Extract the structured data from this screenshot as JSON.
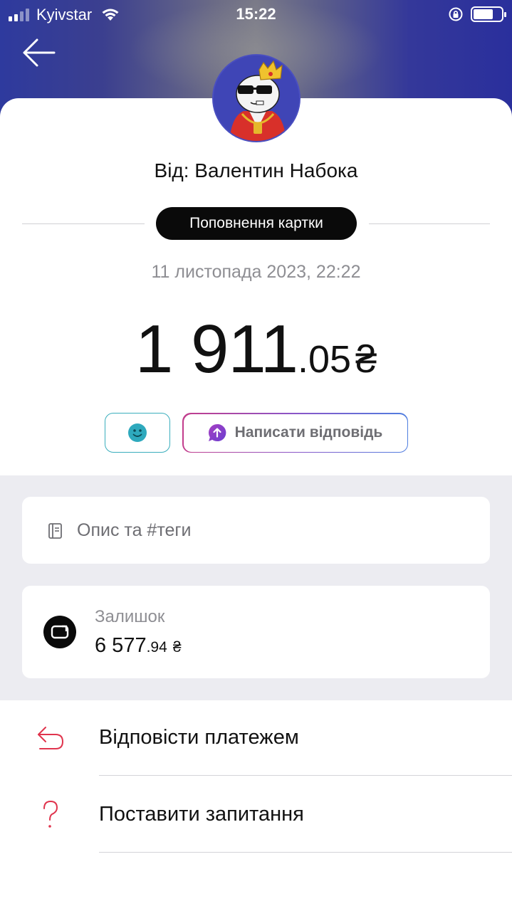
{
  "status_bar": {
    "carrier": "Kyivstar",
    "time": "15:22"
  },
  "header": {
    "back_icon": "arrow-left-icon"
  },
  "transaction": {
    "sender": "Від: Валентин Набока",
    "type": "Поповнення картки",
    "date": "11 листопада 2023, 22:22",
    "amount_integer": "1 911",
    "amount_decimal": ".05",
    "currency": "₴"
  },
  "actions": {
    "emoji_icon": "smiley-icon",
    "reply_label": "Написати відповідь"
  },
  "description": {
    "label": "Опис та #теги"
  },
  "balance": {
    "label": "Залишок",
    "integer": "6 577",
    "decimal": ".94",
    "currency": "₴"
  },
  "menu": [
    {
      "label": "Відповісти платежем",
      "icon": "reply-payment-icon"
    },
    {
      "label": "Поставити запитання",
      "icon": "question-icon"
    }
  ],
  "colors": {
    "header_blue": "#2e3a9e",
    "accent_red": "#e0344d",
    "emoji_teal": "#3aaebd",
    "reply_purple": "#8a3fc0"
  }
}
